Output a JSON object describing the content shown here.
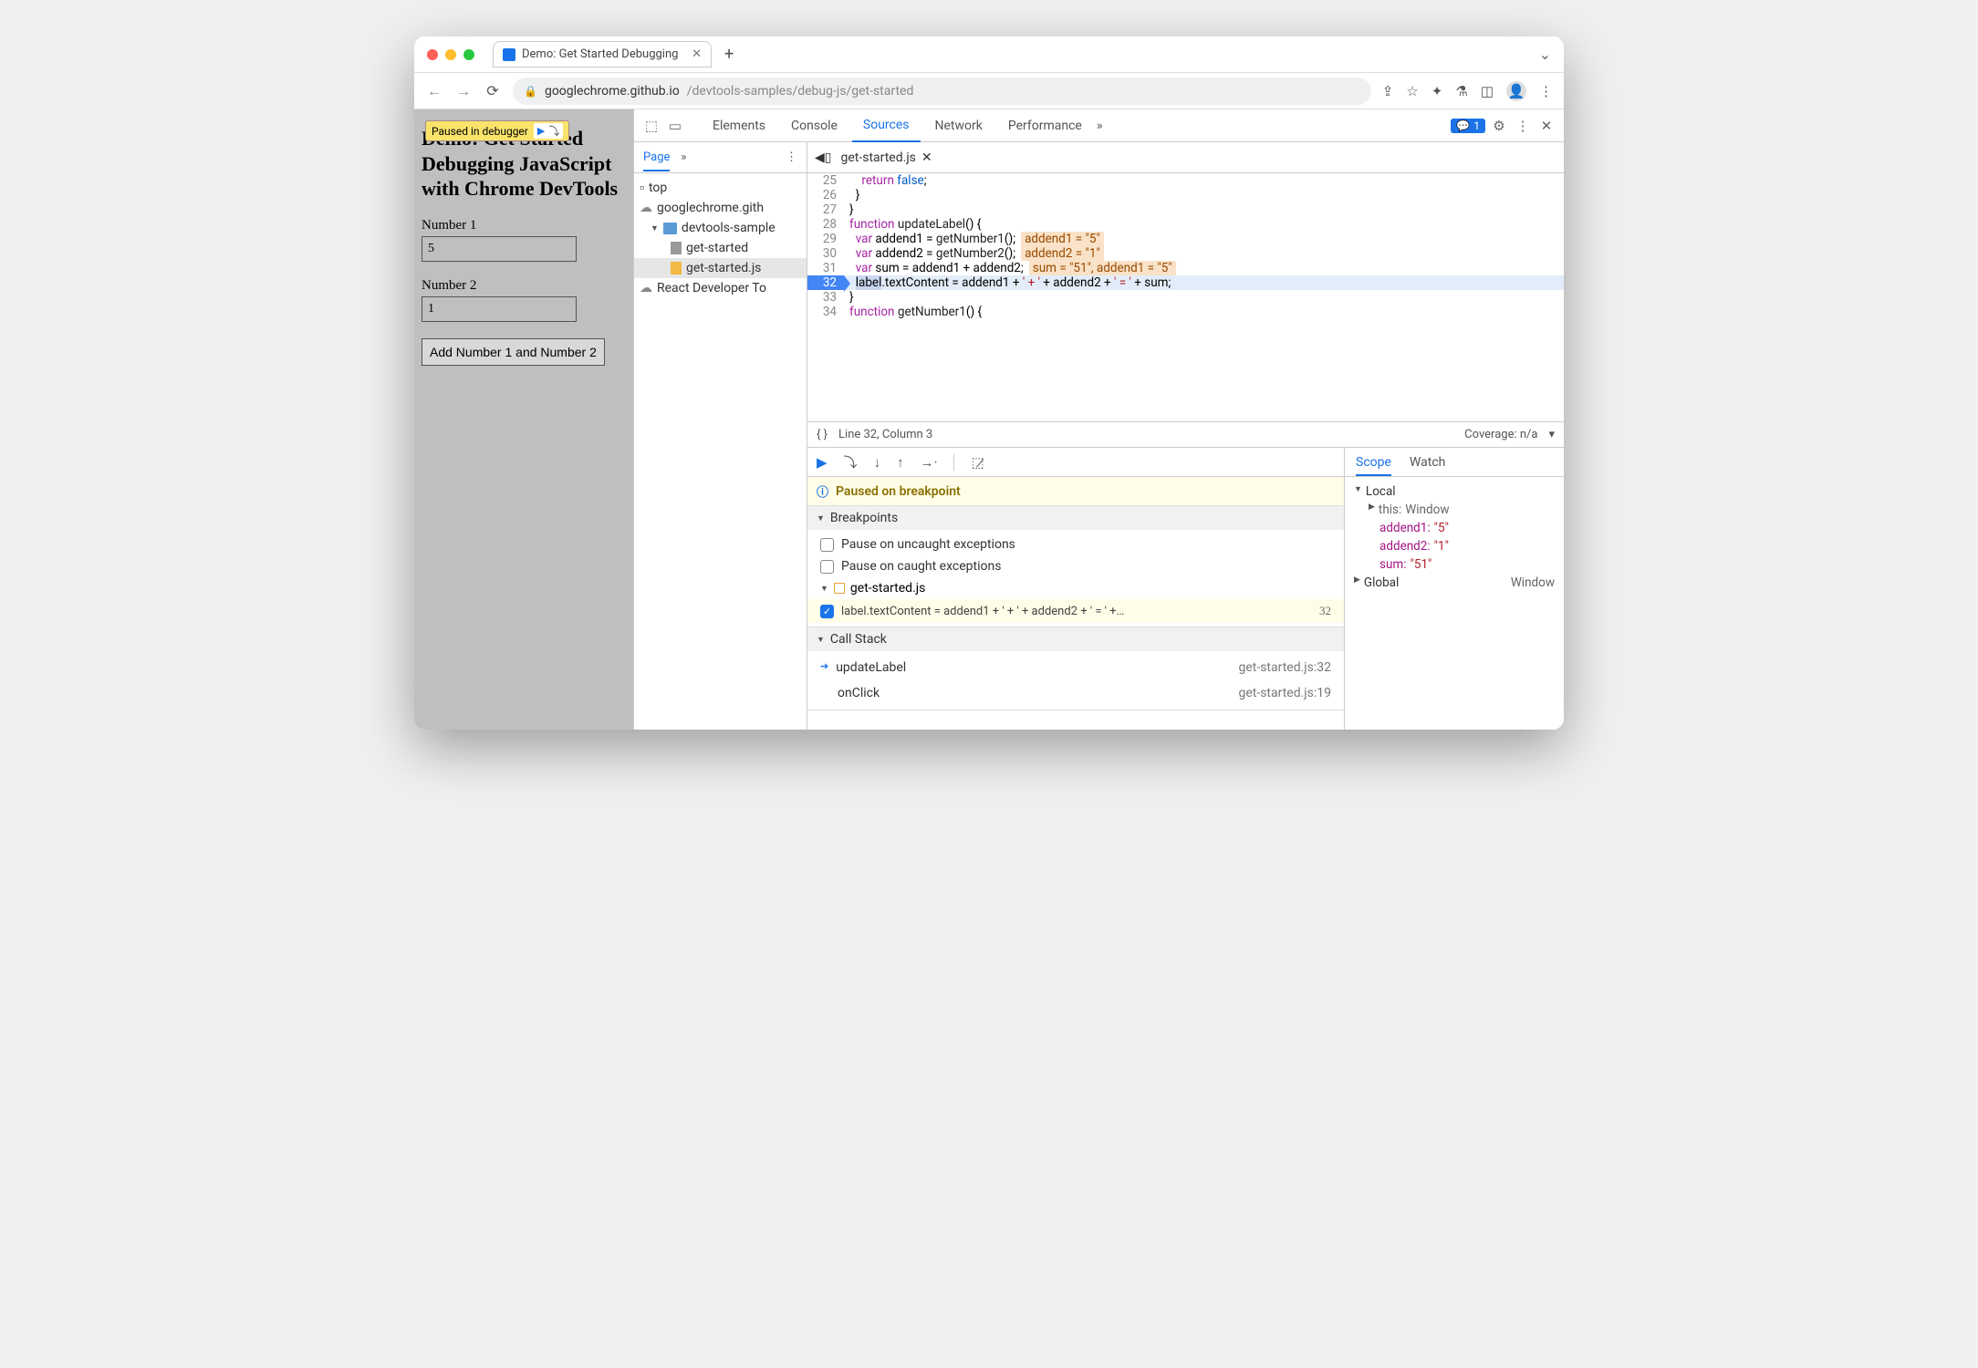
{
  "browser": {
    "tab_title": "Demo: Get Started Debugging",
    "url_host": "googlechrome.github.io",
    "url_path": "/devtools-samples/debug-js/get-started"
  },
  "overlay": {
    "text": "Paused in debugger"
  },
  "page": {
    "heading": "Demo: Get Started Debugging JavaScript with Chrome DevTools",
    "label1": "Number 1",
    "value1": "5",
    "label2": "Number 2",
    "value2": "1",
    "button": "Add Number 1 and Number 2"
  },
  "devtools": {
    "tabs": [
      "Elements",
      "Console",
      "Sources",
      "Network",
      "Performance"
    ],
    "active_tab": "Sources",
    "issues": "1",
    "navigator": {
      "tab": "Page",
      "items": {
        "top": "top",
        "domain": "googlechrome.gith",
        "folder": "devtools-sample",
        "file_html": "get-started",
        "file_js": "get-started.js",
        "ext": "React Developer To"
      }
    },
    "source": {
      "file": "get-started.js",
      "lines": [
        {
          "n": "25",
          "tokens": [
            {
              "t": "    ",
              "c": ""
            },
            {
              "t": "return",
              "c": "kw"
            },
            {
              "t": " ",
              "c": ""
            },
            {
              "t": "false",
              "c": "tok"
            },
            {
              "t": ";",
              "c": ""
            }
          ]
        },
        {
          "n": "26",
          "tokens": [
            {
              "t": "  }",
              "c": ""
            }
          ]
        },
        {
          "n": "27",
          "tokens": [
            {
              "t": "}",
              "c": ""
            }
          ]
        },
        {
          "n": "28",
          "tokens": [
            {
              "t": "function",
              "c": "kw"
            },
            {
              "t": " ",
              "c": ""
            },
            {
              "t": "updateLabel",
              "c": "fn"
            },
            {
              "t": "() {",
              "c": ""
            }
          ]
        },
        {
          "n": "29",
          "tokens": [
            {
              "t": "  ",
              "c": ""
            },
            {
              "t": "var",
              "c": "kw"
            },
            {
              "t": " addend1 = ",
              "c": ""
            },
            {
              "t": "getNumber1",
              "c": "fn"
            },
            {
              "t": "();",
              "c": ""
            }
          ],
          "inline": "addend1 = \"5\""
        },
        {
          "n": "30",
          "tokens": [
            {
              "t": "  ",
              "c": ""
            },
            {
              "t": "var",
              "c": "kw"
            },
            {
              "t": " addend2 = ",
              "c": ""
            },
            {
              "t": "getNumber2",
              "c": "fn"
            },
            {
              "t": "();",
              "c": ""
            }
          ],
          "inline": "addend2 = \"1\""
        },
        {
          "n": "31",
          "tokens": [
            {
              "t": "  ",
              "c": ""
            },
            {
              "t": "var",
              "c": "kw"
            },
            {
              "t": " sum = addend1 + addend2;",
              "c": ""
            }
          ],
          "inline": "sum = \"51\", addend1 = \"5\""
        },
        {
          "n": "32",
          "tokens": [
            {
              "t": "  ",
              "c": ""
            },
            {
              "t": "label",
              "c": "sel-tok"
            },
            {
              "t": ".textContent = addend1 + ",
              "c": ""
            },
            {
              "t": "' + '",
              "c": "st"
            },
            {
              "t": " + addend2 + ",
              "c": ""
            },
            {
              "t": "' = '",
              "c": "st"
            },
            {
              "t": " + sum;",
              "c": ""
            }
          ],
          "br": true,
          "hl": true
        },
        {
          "n": "33",
          "tokens": [
            {
              "t": "}",
              "c": ""
            }
          ]
        },
        {
          "n": "34",
          "tokens": [
            {
              "t": "function",
              "c": "kw"
            },
            {
              "t": " ",
              "c": ""
            },
            {
              "t": "getNumber1",
              "c": "fn"
            },
            {
              "t": "() {",
              "c": ""
            }
          ]
        }
      ],
      "status_pos": "Line 32, Column 3",
      "coverage": "Coverage: n/a"
    },
    "debugger": {
      "paused": "Paused on breakpoint",
      "sections": {
        "breakpoints": "Breakpoints",
        "callstack": "Call Stack"
      },
      "pause_uncaught": "Pause on uncaught exceptions",
      "pause_caught": "Pause on caught exceptions",
      "bp_file": "get-started.js",
      "bp_line": "label.textContent = addend1 + ' + ' + addend2 + ' = ' +…",
      "bp_num": "32",
      "callstack": [
        {
          "fn": "updateLabel",
          "loc": "get-started.js:32",
          "cur": true
        },
        {
          "fn": "onClick",
          "loc": "get-started.js:19",
          "cur": false
        }
      ]
    },
    "scope": {
      "tabs": [
        "Scope",
        "Watch"
      ],
      "local": "Local",
      "this_lbl": "this:",
      "this_val": "Window",
      "vars": [
        {
          "k": "addend1:",
          "v": "\"5\""
        },
        {
          "k": "addend2:",
          "v": "\"1\""
        },
        {
          "k": "sum:",
          "v": "\"51\""
        }
      ],
      "global": "Global",
      "global_val": "Window"
    }
  }
}
